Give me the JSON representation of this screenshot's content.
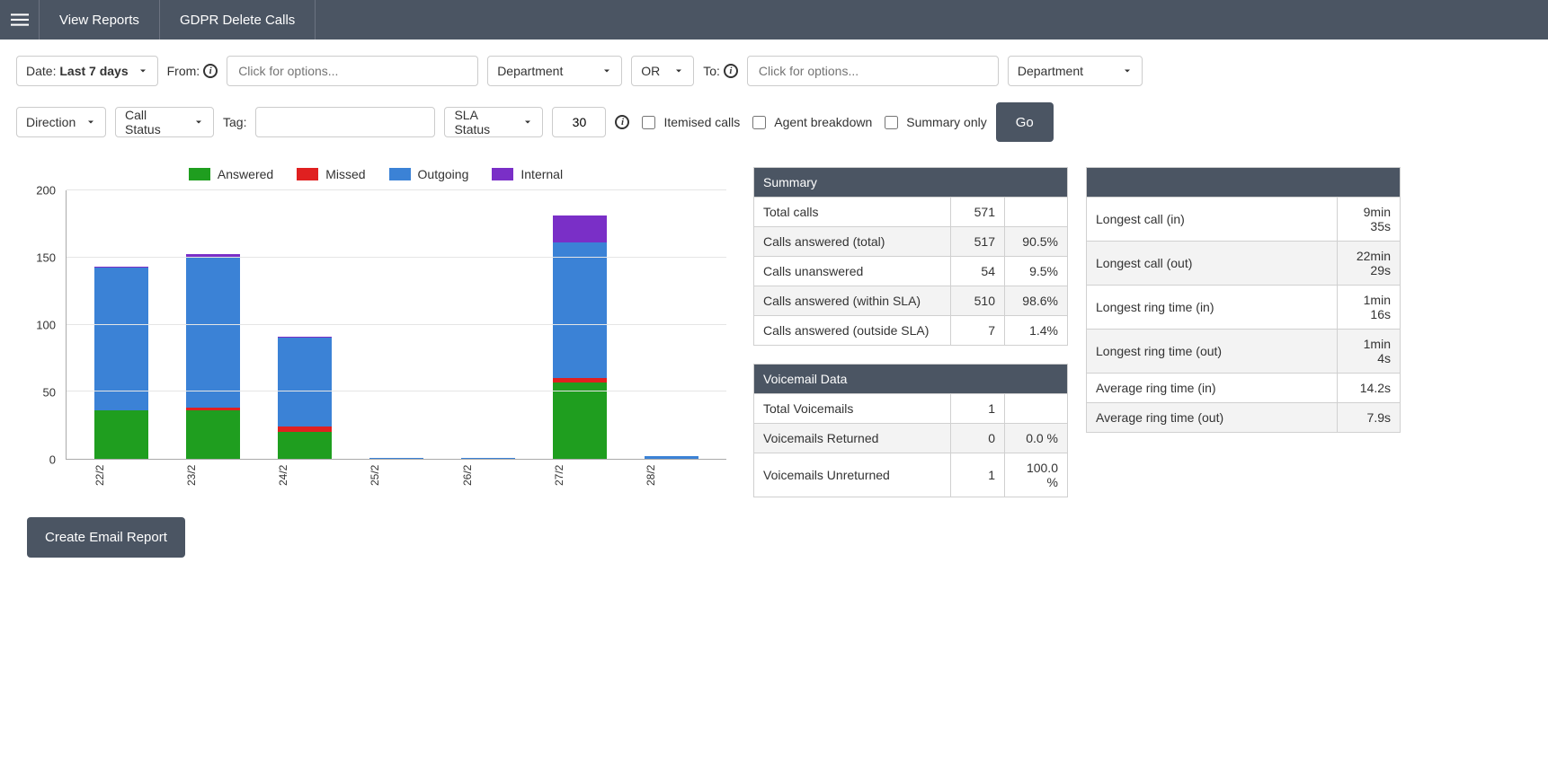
{
  "nav": {
    "view_reports": "View Reports",
    "gdpr_delete": "GDPR Delete Calls"
  },
  "filters": {
    "date_label": "Date:",
    "date_value": "Last 7 days",
    "from_label": "From:",
    "from_placeholder": "Click for options...",
    "from_dept": "Department",
    "logic": "OR",
    "to_label": "To:",
    "to_placeholder": "Click for options...",
    "to_dept": "Department",
    "direction": "Direction",
    "call_status": "Call Status",
    "tag_label": "Tag:",
    "tag_value": "",
    "sla_status": "SLA Status",
    "sla_value": "30",
    "itemised": "Itemised calls",
    "agent_breakdown": "Agent breakdown",
    "summary_only": "Summary only",
    "go": "Go"
  },
  "colors": {
    "answered": "#1f9e1f",
    "missed": "#e02020",
    "outgoing": "#3b82d6",
    "internal": "#7a2fc7"
  },
  "legend": {
    "answered": "Answered",
    "missed": "Missed",
    "outgoing": "Outgoing",
    "internal": "Internal"
  },
  "chart_data": {
    "type": "bar",
    "categories": [
      "22/2",
      "23/2",
      "24/2",
      "25/2",
      "26/2",
      "27/2",
      "28/2"
    ],
    "ylim": [
      0,
      200
    ],
    "yticks": [
      0,
      50,
      100,
      150,
      200
    ],
    "series": [
      {
        "name": "Answered",
        "color": "answered",
        "values": [
          36,
          36,
          20,
          0,
          0,
          57,
          0
        ]
      },
      {
        "name": "Missed",
        "color": "missed",
        "values": [
          0,
          2,
          4,
          0,
          0,
          3,
          0
        ]
      },
      {
        "name": "Outgoing",
        "color": "outgoing",
        "values": [
          106,
          112,
          66,
          1,
          1,
          101,
          2
        ]
      },
      {
        "name": "Internal",
        "color": "internal",
        "values": [
          1,
          2,
          1,
          0,
          0,
          20,
          0
        ]
      }
    ]
  },
  "summary": {
    "title": "Summary",
    "rows": [
      {
        "label": "Total calls",
        "value": "571",
        "pct": ""
      },
      {
        "label": "Calls answered (total)",
        "value": "517",
        "pct": "90.5%"
      },
      {
        "label": "Calls unanswered",
        "value": "54",
        "pct": "9.5%"
      },
      {
        "label": "Calls answered (within SLA)",
        "value": "510",
        "pct": "98.6%"
      },
      {
        "label": "Calls answered (outside SLA)",
        "value": "7",
        "pct": "1.4%"
      }
    ]
  },
  "voicemail": {
    "title": "Voicemail Data",
    "rows": [
      {
        "label": "Total Voicemails",
        "value": "1",
        "pct": ""
      },
      {
        "label": "Voicemails Returned",
        "value": "0",
        "pct": "0.0 %"
      },
      {
        "label": "Voicemails Unreturned",
        "value": "1",
        "pct": "100.0 %"
      }
    ]
  },
  "metrics": {
    "rows": [
      {
        "label": "Longest call (in)",
        "value": "9min 35s"
      },
      {
        "label": "Longest call (out)",
        "value": "22min 29s"
      },
      {
        "label": "Longest ring time (in)",
        "value": "1min 16s"
      },
      {
        "label": "Longest ring time (out)",
        "value": "1min 4s"
      },
      {
        "label": "Average ring time (in)",
        "value": "14.2s"
      },
      {
        "label": "Average ring time (out)",
        "value": "7.9s"
      }
    ]
  },
  "footer": {
    "create_report": "Create Email Report"
  }
}
